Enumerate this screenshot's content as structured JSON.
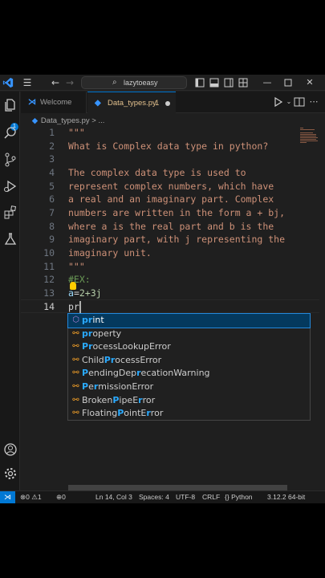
{
  "titlebar": {
    "search_text": "lazytoeasy"
  },
  "activity": {
    "badge": "1"
  },
  "tabs": [
    {
      "label": "Welcome"
    },
    {
      "label": "Data_types.py",
      "problems": "1"
    }
  ],
  "breadcrumb": "Data_types.py > ...",
  "editor": {
    "line_numbers": [
      "1",
      "2",
      "3",
      "4",
      "5",
      "6",
      "7",
      "8",
      "9",
      "10",
      "11",
      "12",
      "13",
      "14"
    ],
    "lines": [
      "\"\"\"",
      "What is Complex data type in python?",
      "",
      "The complex data type is used to",
      "represent complex numbers, which have",
      "a real and an imaginary part. Complex",
      "numbers are written in the form a + bj,",
      "where a is the real part and b is the",
      "imaginary part, with j representing the",
      "imaginary unit.",
      "\"\"\"",
      "#EX:",
      "a=2+3j",
      "pr"
    ],
    "active_line": 14
  },
  "suggestions": {
    "typed": "pr",
    "items": [
      {
        "kind": "cube-icon",
        "label": "print"
      },
      {
        "kind": "class-icon",
        "label": "property"
      },
      {
        "kind": "class-icon",
        "label": "ProcessLookupError"
      },
      {
        "kind": "class-icon",
        "label": "ChildProcessError"
      },
      {
        "kind": "class-icon",
        "label": "PendingDeprecationWarning"
      },
      {
        "kind": "class-icon",
        "label": "PermissionError"
      },
      {
        "kind": "class-icon",
        "label": "BrokenPipeError"
      },
      {
        "kind": "class-icon",
        "label": "FloatingPointError"
      }
    ]
  },
  "status": {
    "errors": "0",
    "warnings": "1",
    "ports": "0",
    "position": "Ln 14, Col 3",
    "spaces": "Spaces: 4",
    "encoding": "UTF-8",
    "eol": "CRLF",
    "language": "Python",
    "interpreter": "3.12.2 64-bit"
  },
  "colors": {
    "accent": "#0078d4",
    "string": "#ce9178",
    "comment": "#6a9955",
    "match_highlight": "#2aaaff",
    "modified_tab": "#e2c08d"
  }
}
